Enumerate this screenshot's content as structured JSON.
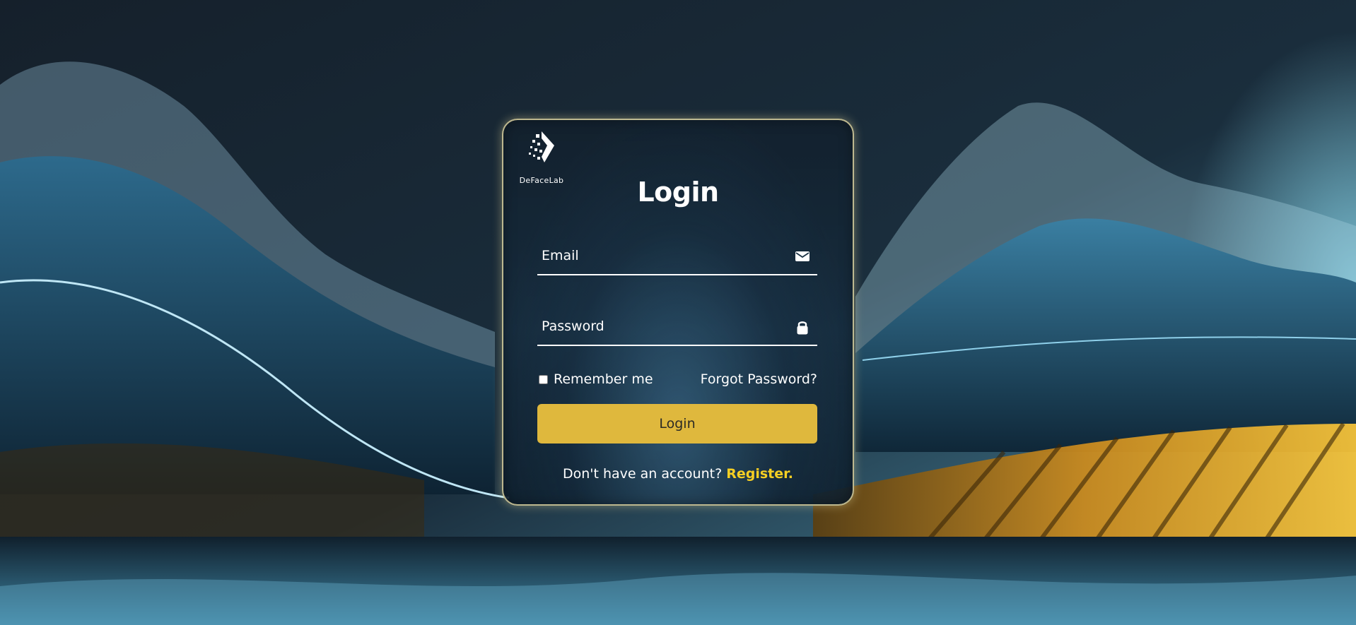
{
  "brand": {
    "logo_text": "DeFaceLab"
  },
  "form": {
    "title": "Login",
    "email_placeholder": "Email",
    "email_icon": "envelope-icon",
    "password_placeholder": "Password",
    "password_icon": "lock-icon",
    "remember_label": "Remember me",
    "remember_checked": false,
    "forgot_label": "Forgot Password?",
    "login_label": "Login",
    "register_prompt": "Don't have an account?",
    "register_label": "Register."
  },
  "colors": {
    "accent": "#dfb83d",
    "register_link": "#f6cf23",
    "card_border": "#dcd2a0"
  }
}
